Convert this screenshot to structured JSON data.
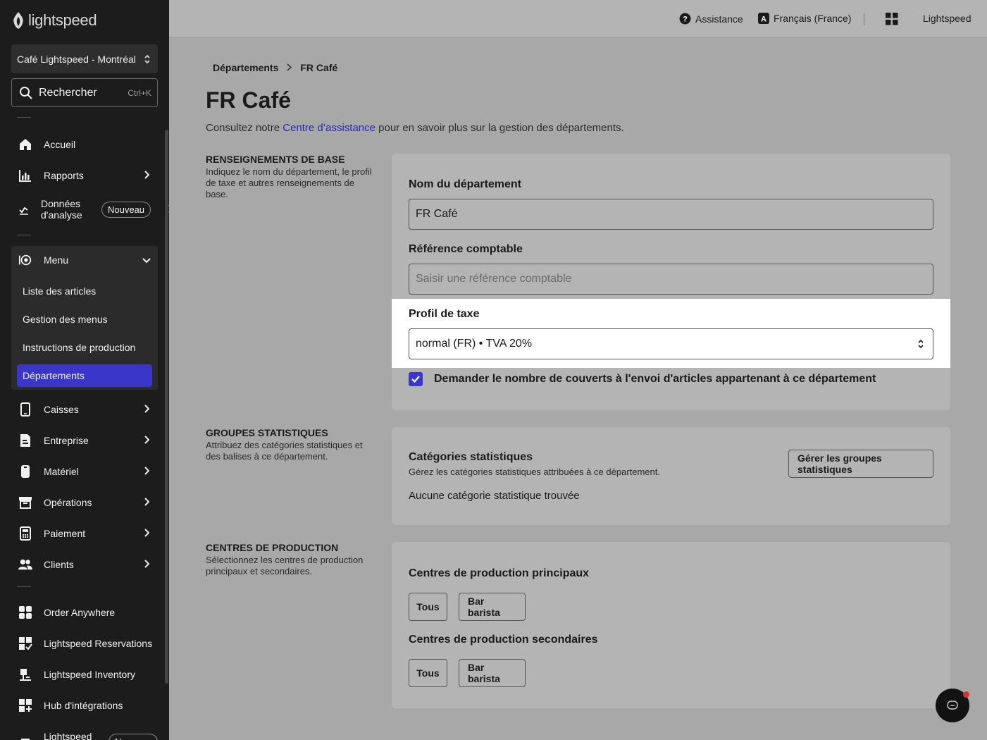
{
  "brand": {
    "logo_text": "lightspeed"
  },
  "sidebar": {
    "location": "Café Lightspeed - Montréal",
    "search": {
      "label": "Rechercher",
      "shortcut": "Ctrl+K"
    },
    "items": [
      {
        "label": "Accueil",
        "icon": "home-icon"
      },
      {
        "label": "Rapports",
        "icon": "bar-chart-icon"
      },
      {
        "label": "Données d'analyse",
        "icon": "analytics-icon",
        "badge": "Nouveau"
      },
      {
        "label": "Menu",
        "icon": "menu-icon"
      },
      {
        "label": "Caisses",
        "icon": "tablet-icon"
      },
      {
        "label": "Entreprise",
        "icon": "business-icon"
      },
      {
        "label": "Matériel",
        "icon": "hardware-icon"
      },
      {
        "label": "Opérations",
        "icon": "archive-icon"
      },
      {
        "label": "Paiement",
        "icon": "payment-icon"
      },
      {
        "label": "Clients",
        "icon": "customers-icon"
      },
      {
        "label": "Order Anywhere",
        "icon": "order-anywhere-icon"
      },
      {
        "label": "Lightspeed Reservations",
        "icon": "reservations-icon"
      },
      {
        "label": "Lightspeed Inventory",
        "icon": "inventory-icon"
      },
      {
        "label": "Hub d'intégrations",
        "icon": "integrations-icon"
      },
      {
        "label": "Lightspeed",
        "icon": "lightspeed-more-icon",
        "badge": "Nouveau"
      }
    ],
    "menu_sub": [
      {
        "label": "Liste des articles"
      },
      {
        "label": "Gestion des menus"
      },
      {
        "label": "Instructions de production"
      },
      {
        "label": "Départements"
      }
    ]
  },
  "topbar": {
    "help": "Assistance",
    "language": "Français (France)",
    "account": "Lightspeed"
  },
  "breadcrumb": {
    "parent": "Départements",
    "current": "FR Café"
  },
  "page": {
    "title": "FR Café",
    "intro_before": "Consultez notre ",
    "intro_link": "Centre d’assistance",
    "intro_after": " pour en savoir plus sur la gestion des départements."
  },
  "basic": {
    "title": "RENSEIGNEMENTS DE BASE",
    "desc": "Indiquez le nom du département, le profil de taxe et autres renseignements de base.",
    "name_label": "Nom du département",
    "name_value": "FR Café",
    "ref_label": "Référence comptable",
    "ref_placeholder": "Saisir une référence comptable",
    "tax_label": "Profil de taxe",
    "tax_value": "normal (FR) • TVA 20%",
    "covers_label": "Demander le nombre de couverts à l'envoi d'articles appartenant à ce département",
    "covers_checked": true
  },
  "stats": {
    "title": "GROUPES STATISTIQUES",
    "desc": "Attribuez des catégories statistiques et des balises à ce département.",
    "cat_title": "Catégories statistiques",
    "cat_desc": "Gérez les catégories statistiques attribuées à ce département.",
    "empty": "Aucune catégorie statistique trouvée",
    "manage_button": "Gérer les groupes statistiques"
  },
  "production": {
    "title": "CENTRES DE PRODUCTION",
    "desc": "Sélectionnez les centres de production principaux et secondaires.",
    "primary_title": "Centres de production principaux",
    "secondary_title": "Centres de production secondaires",
    "primary_options": [
      "Tous",
      "Bar barista"
    ],
    "secondary_options": [
      "Tous",
      "Bar barista"
    ]
  },
  "colors": {
    "accent": "#3a36c9",
    "link": "#2a28b8",
    "sidebar_bg": "#1c1c1c",
    "notification": "#e0312b"
  }
}
